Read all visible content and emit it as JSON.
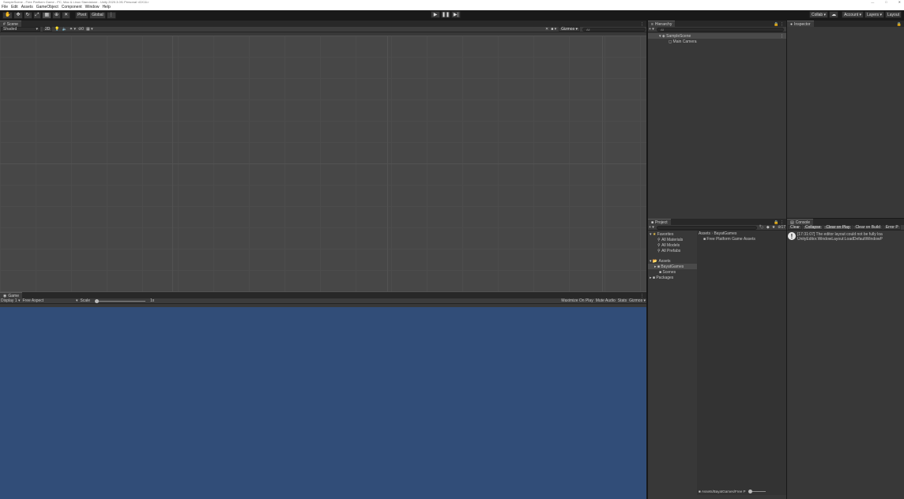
{
  "title": "SampleScene - Free Platform Game - PC, Mac & Linux Standalone - Unity 2020.3.0f1 Personal <DX11>",
  "window_controls": [
    "—",
    "□",
    "✕"
  ],
  "menu": [
    "File",
    "Edit",
    "Assets",
    "GameObject",
    "Component",
    "Window",
    "Help"
  ],
  "toolbar": {
    "pivot": "Pivot",
    "global": "Global",
    "collab": "Collab",
    "account": "Account",
    "layers": "Layers",
    "layout": "Layout"
  },
  "scene": {
    "tab": "Scene",
    "shading": "Shaded",
    "mode_2d": "2D",
    "gizmos": "Gizmos",
    "search": "All",
    "layer_count": "0"
  },
  "game": {
    "tab": "Game",
    "display": "Display 1",
    "aspect": "Free Aspect",
    "scale_label": "Scale",
    "scale_value": "1x",
    "maximize": "Maximize On Play",
    "mute": "Mute Audio",
    "stats": "Stats",
    "gizmos": "Gizmos"
  },
  "hierarchy": {
    "tab": "Hierarchy",
    "search_placeholder": "All",
    "scene": "SampleScene",
    "items": [
      "Main Camera"
    ]
  },
  "inspector": {
    "tab": "Inspector"
  },
  "project": {
    "tab": "Project",
    "badge": "17",
    "favorites": "Favorites",
    "favorite_items": [
      "All Materials",
      "All Models",
      "All Prefabs"
    ],
    "assets": "Assets",
    "asset_tree": [
      "BayatGames",
      "Scenes"
    ],
    "packages": "Packages",
    "breadcrumb_root": "Assets",
    "breadcrumb_leaf": "BayatGames",
    "folder_items": [
      "Free Platform Game Assets"
    ],
    "footer_path": "Assets/BayatGames/Free P"
  },
  "console": {
    "tab": "Console",
    "buttons": [
      "Clear",
      "Collapse",
      "Clear on Play",
      "Clear on Build",
      "Error P"
    ],
    "message_line1": "[17:31:07] The editor layout could not be fully loa",
    "message_line2": "UnityEditor.WindowLayout:LoadDefaultWindowP"
  },
  "colors": {
    "game_background": "#314d78",
    "scene_background": "#474747",
    "panel": "#383838"
  }
}
